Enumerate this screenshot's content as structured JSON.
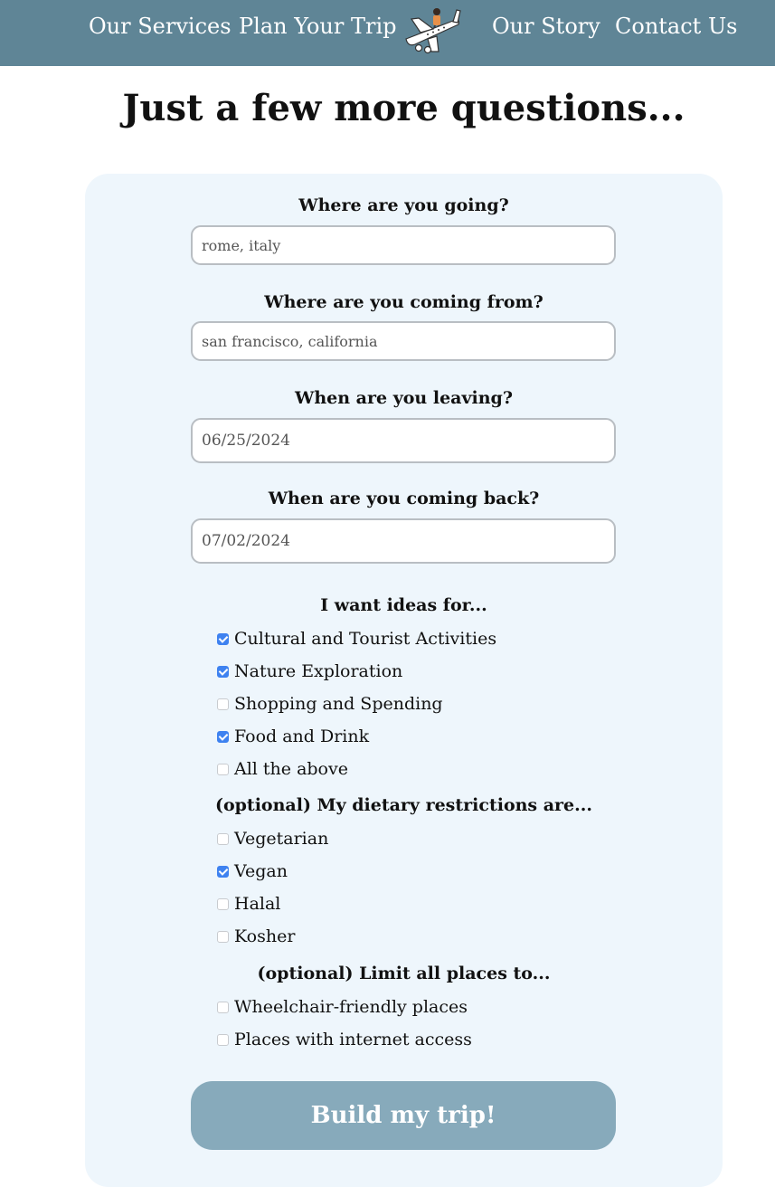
{
  "nav": {
    "links": [
      "Our Services",
      "Plan Your Trip",
      "Our Story",
      "Contact Us"
    ],
    "logo_icon": "airplane-traveler-logo-icon",
    "background": "#5f8596"
  },
  "page_title": "Just a few more questions...",
  "form": {
    "destination": {
      "label": "Where are you going?",
      "placeholder": "rome, italy"
    },
    "origin": {
      "label": "Where are you coming from?",
      "placeholder": "san francisco, california"
    },
    "depart": {
      "label": "When are you leaving?",
      "value": "06/25/2024"
    },
    "return": {
      "label": "When are you coming back?",
      "value": "07/02/2024"
    },
    "ideas": {
      "title": "I want ideas for...",
      "options": [
        {
          "label": "Cultural and Tourist Activities",
          "checked": true
        },
        {
          "label": "Nature Exploration",
          "checked": true
        },
        {
          "label": "Shopping and Spending",
          "checked": false
        },
        {
          "label": "Food and Drink",
          "checked": true
        },
        {
          "label": "All the above",
          "checked": false
        }
      ]
    },
    "diet": {
      "title": "(optional) My dietary restrictions are...",
      "options": [
        {
          "label": "Vegetarian",
          "checked": false
        },
        {
          "label": "Vegan",
          "checked": true
        },
        {
          "label": "Halal",
          "checked": false
        },
        {
          "label": "Kosher",
          "checked": false
        }
      ]
    },
    "limits": {
      "title": "(optional) Limit all places to...",
      "options": [
        {
          "label": "Wheelchair-friendly places",
          "checked": false
        },
        {
          "label": "Places with internet access",
          "checked": false
        }
      ]
    },
    "submit_label": "Build my trip!"
  },
  "colors": {
    "nav": "#5f8596",
    "card": "#eef6fc",
    "button": "#87aabb",
    "checkbox_checked": "#3e82f0"
  }
}
